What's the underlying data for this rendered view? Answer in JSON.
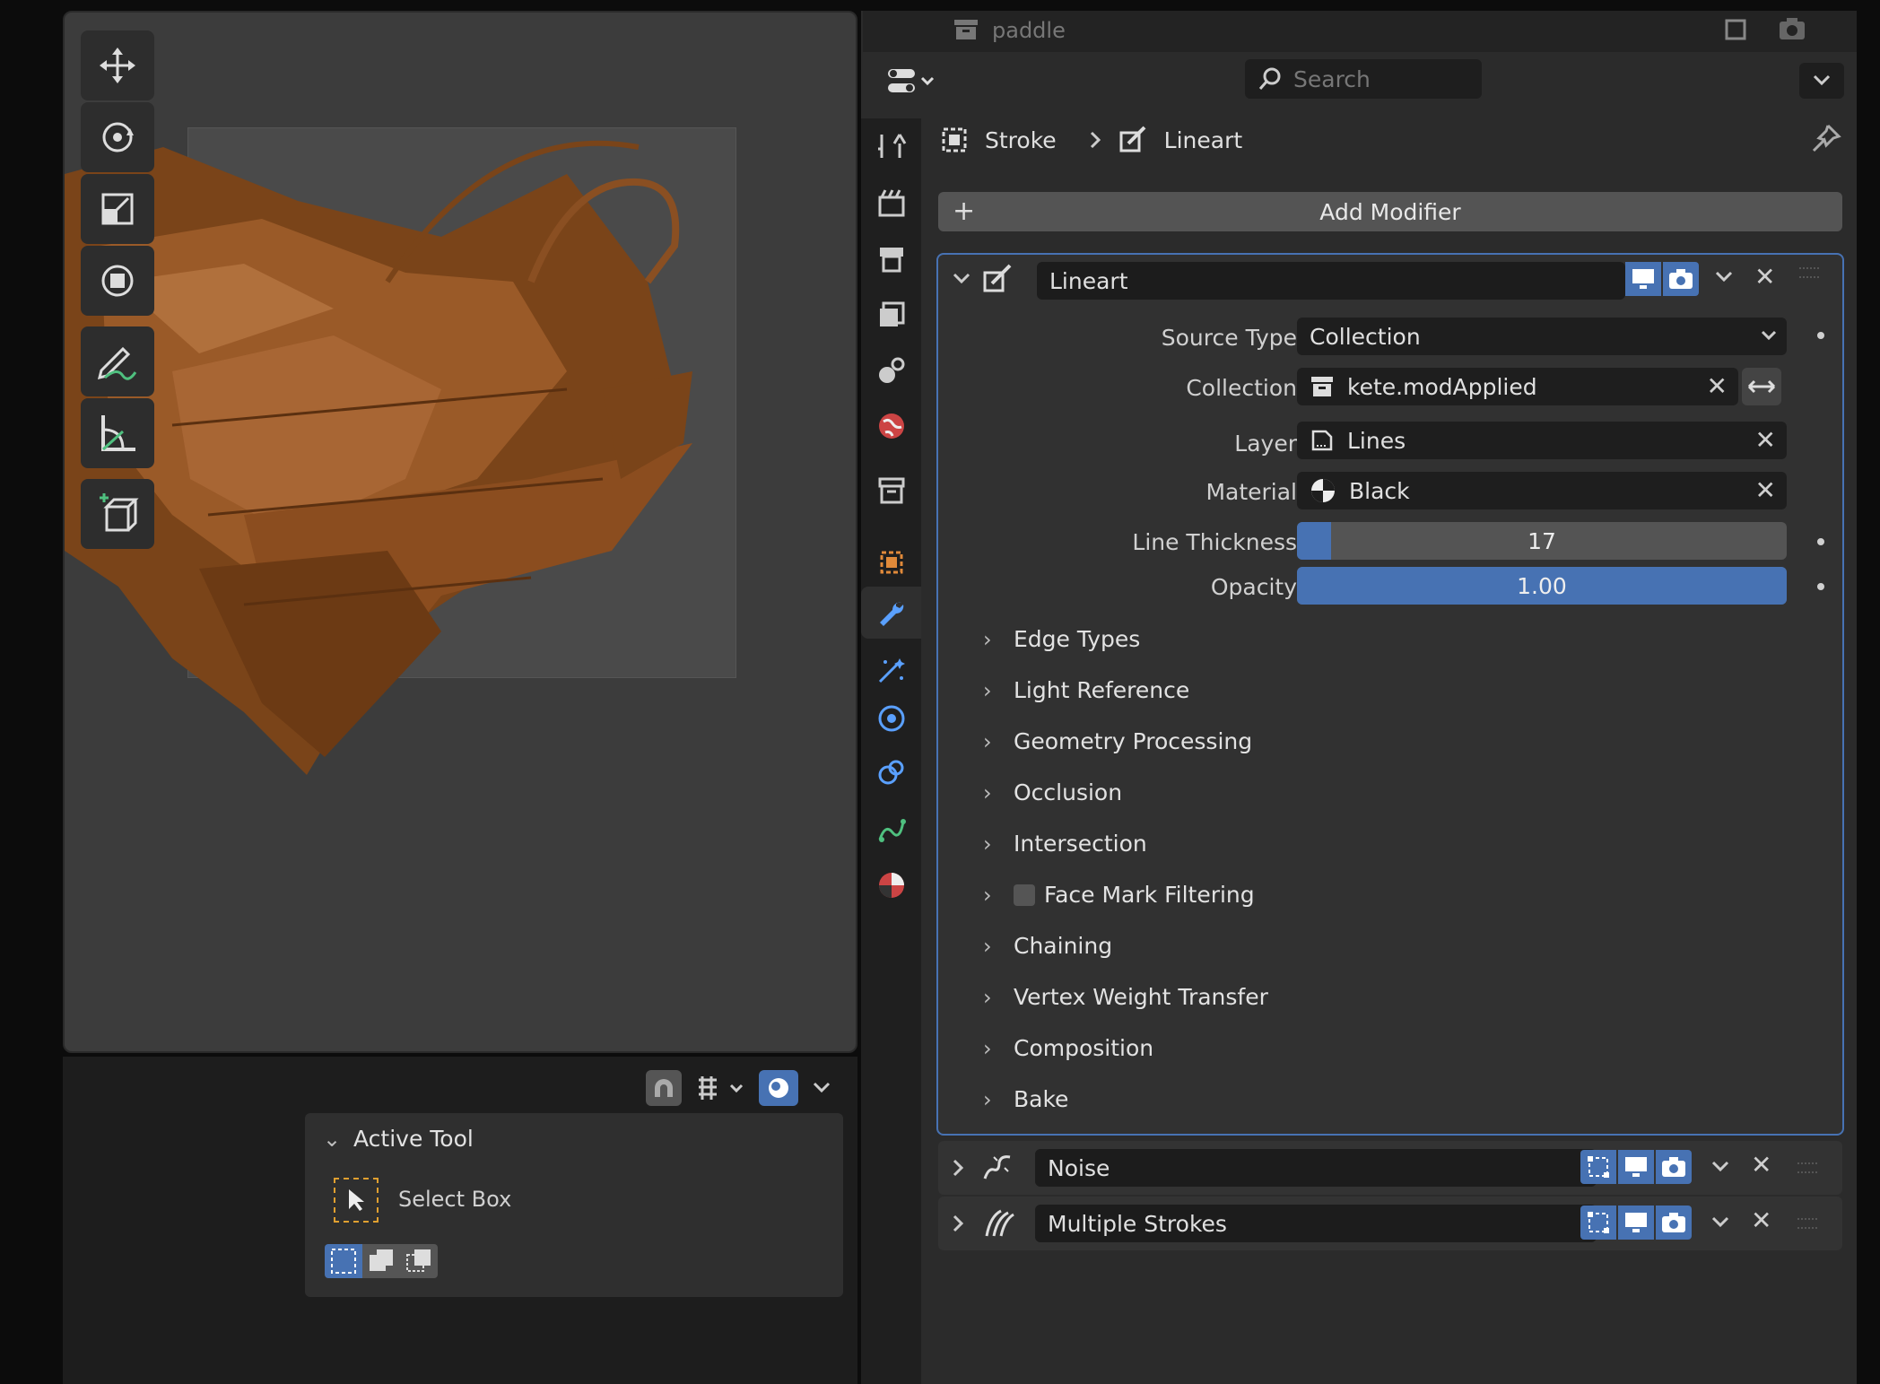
{
  "window": {
    "title": "paddle"
  },
  "search": {
    "placeholder": "Search"
  },
  "breadcrumb": {
    "object": "Stroke",
    "modifier": "Lineart"
  },
  "add_modifier": {
    "label": "Add Modifier"
  },
  "lineart": {
    "name": "Lineart",
    "fields": {
      "source_type": {
        "label": "Source Type",
        "value": "Collection"
      },
      "collection": {
        "label": "Collection",
        "value": "kete.modApplied"
      },
      "layer": {
        "label": "Layer",
        "value": "Lines"
      },
      "material": {
        "label": "Material",
        "value": "Black"
      },
      "line_thickness": {
        "label": "Line Thickness",
        "value": "17",
        "fill": 0.07
      },
      "opacity": {
        "label": "Opacity",
        "value": "1.00",
        "fill": 1.0
      }
    },
    "subpanels": [
      "Edge Types",
      "Light Reference",
      "Geometry Processing",
      "Occlusion",
      "Intersection",
      "Face Mark Filtering",
      "Chaining",
      "Vertex Weight Transfer",
      "Composition",
      "Bake"
    ]
  },
  "other_modifiers": [
    {
      "name": "Noise"
    },
    {
      "name": "Multiple Strokes"
    }
  ],
  "active_tool": {
    "title": "Active Tool",
    "tool": "Select Box"
  },
  "colors": {
    "accent": "#4772b3",
    "panel": "#2b2b2b",
    "field": "#1e1e1e",
    "wood": "#8a4f22"
  }
}
